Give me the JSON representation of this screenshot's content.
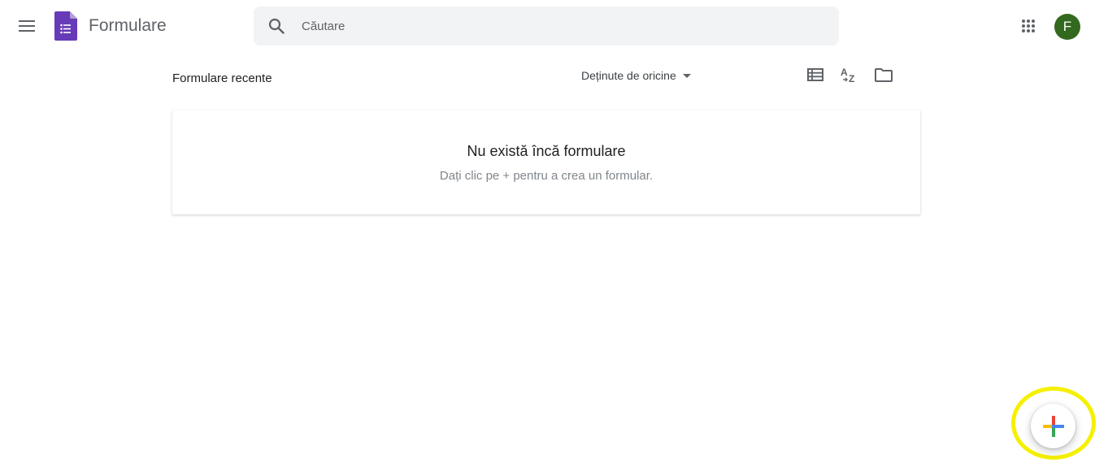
{
  "app": {
    "title": "Formulare",
    "logo_color": "#673ab7"
  },
  "search": {
    "placeholder": "Căutare",
    "value": ""
  },
  "account": {
    "avatar_initial": "F",
    "avatar_color": "#33691e"
  },
  "list_header": {
    "title": "Formulare recente",
    "owner_filter": "Deținute de oricine"
  },
  "toolbar": {
    "icons": [
      "list-view-icon",
      "sort-az-icon",
      "folder-icon"
    ]
  },
  "empty_state": {
    "title": "Nu există încă formulare",
    "subtitle": "Dați clic pe + pentru a crea un formular."
  },
  "fab": {
    "icon": "plus-icon",
    "colors": [
      "#ea4335",
      "#4285f4",
      "#34a853",
      "#fbbc04"
    ],
    "highlight_color": "#f5f000"
  }
}
